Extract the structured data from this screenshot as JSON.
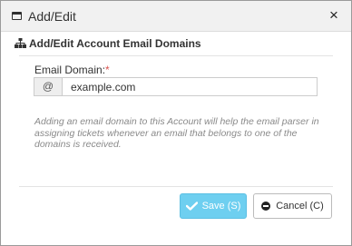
{
  "dialog": {
    "title": "Add/Edit",
    "close_glyph": "×",
    "section_title": "Add/Edit Account Email Domains",
    "field": {
      "label": "Email Domain:",
      "required_marker": "*",
      "addon": "@",
      "value": "example.com"
    },
    "help_text": "Adding an email domain to this Account will help the email parser in assigning tickets whenever an email that belongs to one of the domains is received.",
    "buttons": {
      "save_label": "Save (S)",
      "cancel_label": "Cancel (C)"
    }
  },
  "icons": {
    "window": "window-icon",
    "section": "sitemap-icon",
    "close": "close-icon",
    "save": "check-icon",
    "cancel": "ban-icon"
  },
  "colors": {
    "save_button": "#6ecff0",
    "required": "#d9534f",
    "help_text": "#8a8a8a"
  }
}
